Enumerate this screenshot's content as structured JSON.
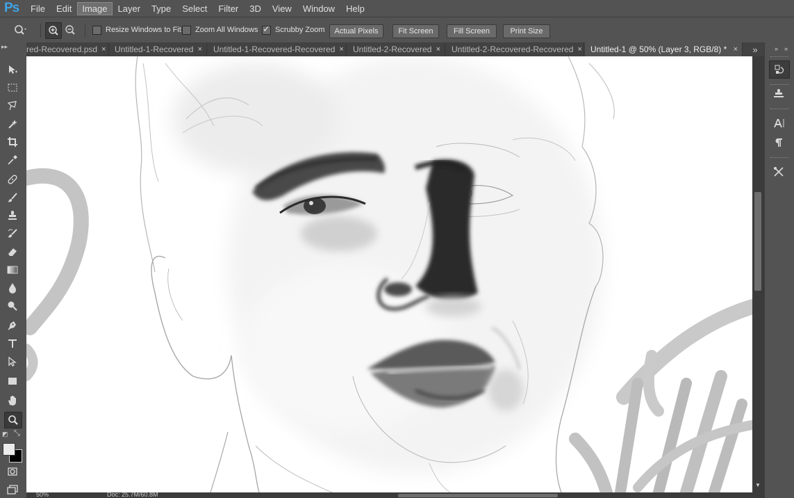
{
  "app": {
    "logo": "Ps"
  },
  "menu": [
    "File",
    "Edit",
    "Image",
    "Layer",
    "Type",
    "Select",
    "Filter",
    "3D",
    "View",
    "Window",
    "Help"
  ],
  "menu_active": "Image",
  "options": {
    "resize_windows": "Resize Windows to Fit",
    "zoom_all": "Zoom All Windows",
    "scrubby": "Scrubby Zoom",
    "actual_pixels": "Actual Pixels",
    "fit_screen": "Fit Screen",
    "fill_screen": "Fill Screen",
    "print_size": "Print Size"
  },
  "tabs": [
    {
      "label": "red-Recovered.psd",
      "active": false
    },
    {
      "label": "Untitled-1-Recovered",
      "active": false
    },
    {
      "label": "Untitled-1-Recovered-Recovered",
      "active": false
    },
    {
      "label": "Untitled-2-Recovered",
      "active": false
    },
    {
      "label": "Untitled-2-Recovered-Recovered",
      "active": false
    },
    {
      "label": "Untitled-1 @ 50% (Layer 3, RGB/8) *",
      "active": true
    }
  ],
  "tab_close": "×",
  "tab_overflow": "»",
  "status": {
    "zoom": "50%",
    "doc": "Doc: 25.7M/60.8M"
  },
  "colors": {
    "accent": "#3fa4e6",
    "ui_bg": "#535353",
    "canvas": "#ffffff"
  }
}
